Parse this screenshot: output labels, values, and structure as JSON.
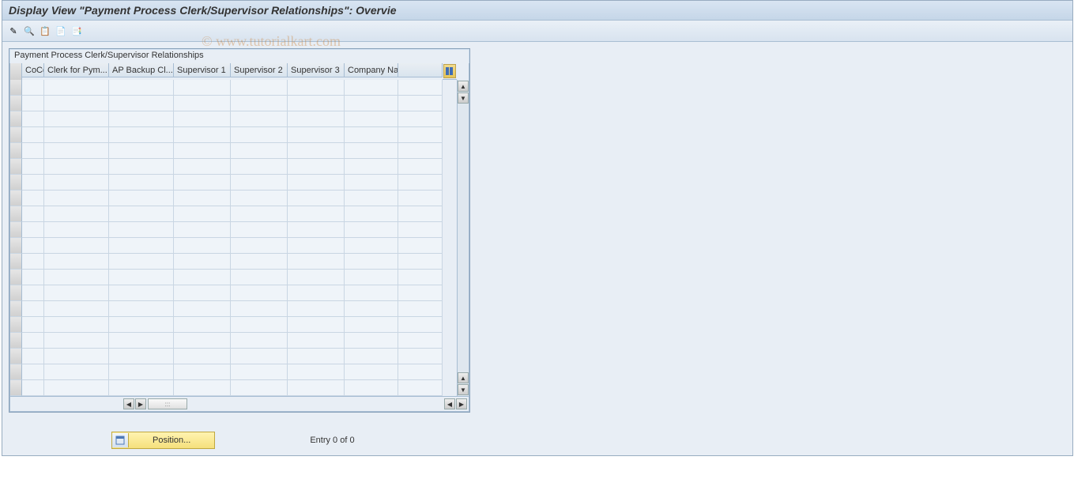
{
  "header": {
    "title": "Display View \"Payment Process Clerk/Supervisor Relationships\": Overvie"
  },
  "watermark": "© www.tutorialkart.com",
  "toolbar": {
    "buttons": [
      {
        "name": "change-display-mode",
        "glyph": "✎"
      },
      {
        "name": "other-object",
        "glyph": "🔍"
      },
      {
        "name": "select-all",
        "glyph": "📋"
      },
      {
        "name": "select-block",
        "glyph": "📄"
      },
      {
        "name": "deselect-all",
        "glyph": "📑"
      }
    ]
  },
  "table": {
    "title": "Payment Process Clerk/Supervisor Relationships",
    "columns": [
      {
        "key": "cocd",
        "label": "CoCd",
        "widthClass": "cw0"
      },
      {
        "key": "clerk",
        "label": "Clerk for Pym...",
        "widthClass": "cw1"
      },
      {
        "key": "backup",
        "label": "AP Backup Cl...",
        "widthClass": "cw2"
      },
      {
        "key": "sup1",
        "label": "Supervisor 1",
        "widthClass": "cw3"
      },
      {
        "key": "sup2",
        "label": "Supervisor 2",
        "widthClass": "cw4"
      },
      {
        "key": "sup3",
        "label": "Supervisor 3",
        "widthClass": "cw5"
      },
      {
        "key": "co",
        "label": "Company Na",
        "widthClass": "cw6"
      },
      {
        "key": "pad",
        "label": "",
        "widthClass": "cw7"
      }
    ],
    "rowCount": 20
  },
  "footer": {
    "position_label": "Position...",
    "entry_text": "Entry 0 of 0"
  }
}
